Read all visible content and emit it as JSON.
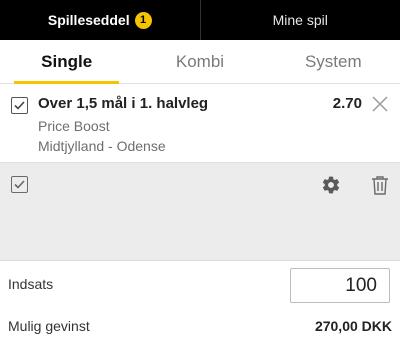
{
  "top_tabs": [
    {
      "label": "Spilleseddel",
      "badge": "1",
      "active": true
    },
    {
      "label": "Mine spil",
      "active": false
    }
  ],
  "sub_tabs": [
    {
      "label": "Single",
      "active": true
    },
    {
      "label": "Kombi",
      "active": false
    },
    {
      "label": "System",
      "active": false
    }
  ],
  "bet": {
    "checked": true,
    "title": "Over 1,5 mål i 1. halvleg",
    "tag": "Price Boost",
    "match": "Midtjylland - Odense",
    "odds": "2.70",
    "close_icon": "close-icon"
  },
  "toolbar": {
    "select_all_checked": true,
    "settings_icon": "gear-icon",
    "delete_icon": "trash-icon"
  },
  "stake": {
    "label": "Indsats",
    "value": "100"
  },
  "potential_win": {
    "label": "Mulig gevinst",
    "value": "270,00 DKK"
  },
  "colors": {
    "accent": "#f5c400",
    "topbar": "#000000",
    "panel_grey": "#ececec"
  }
}
